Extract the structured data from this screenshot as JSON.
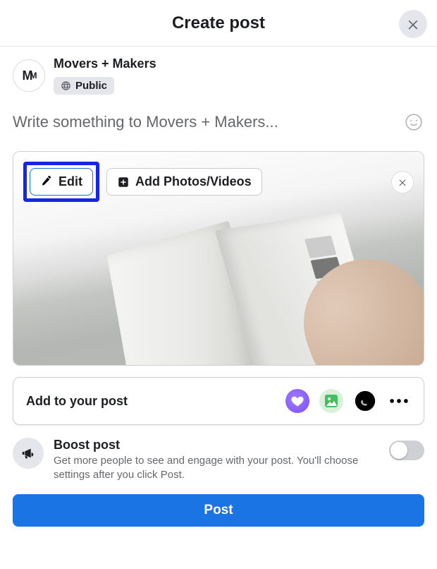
{
  "header": {
    "title": "Create post"
  },
  "author": {
    "avatar_text": "M",
    "name": "Movers + Makers",
    "privacy": "Public"
  },
  "composer": {
    "placeholder": "Write something to Movers + Makers..."
  },
  "media": {
    "edit_label": "Edit",
    "add_media_label": "Add Photos/Videos"
  },
  "add_row": {
    "label": "Add to your post"
  },
  "boost": {
    "title": "Boost post",
    "description": "Get more people to see and engage with your post. You'll choose settings after you click Post.",
    "enabled": false
  },
  "submit": {
    "label": "Post"
  },
  "colors": {
    "primary": "#1b74e4",
    "highlight": "#1726e3"
  }
}
